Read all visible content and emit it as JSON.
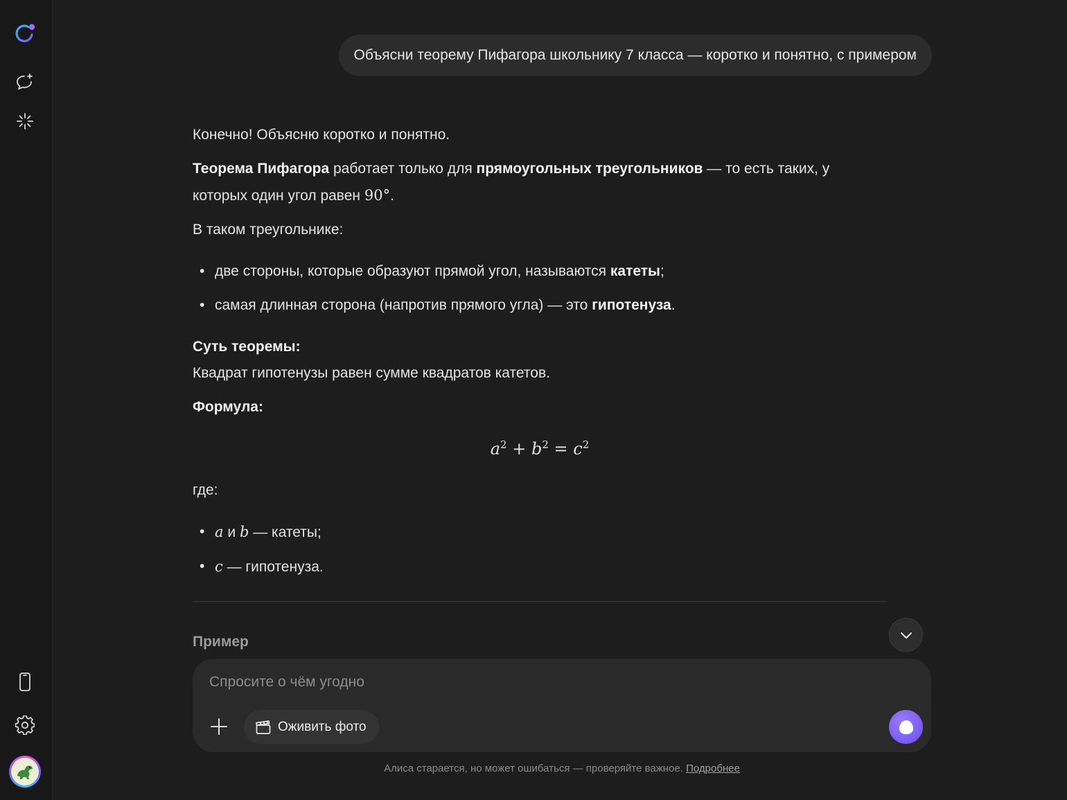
{
  "user_message": "Объясни теорему Пифагора школьнику 7 класса — коротко и понятно, с примером",
  "answer": {
    "intro": "Конечно! Объясню коротко и понятно.",
    "p2_bold1": "Теорема Пифагора",
    "p2_t1": " работает только для ",
    "p2_bold2": "прямоугольных треугольников",
    "p2_t2": " — то есть таких, у которых один угол равен ",
    "p2_angle": "90°",
    "p2_end": ".",
    "p3": "В таком треугольнике:",
    "bullet1_text": "две стороны, которые образуют прямой угол, называются ",
    "bullet1_bold": "катеты",
    "bullet1_end": ";",
    "bullet2_text": "самая длинная сторона (напротив прямого угла) — это ",
    "bullet2_bold": "гипотенуза",
    "bullet2_end": ".",
    "essence_title": "Суть теоремы:",
    "essence_text": "Квадрат гипотенузы равен сумме квадратов катетов.",
    "formula_title": "Формула:",
    "formula": {
      "a": "a",
      "b": "b",
      "c": "c",
      "exp": "2",
      "plus": "+",
      "eq": "="
    },
    "where": "где:",
    "var_a": "a",
    "var_and": " и ",
    "var_b": "b",
    "legs_text": " — катеты;",
    "var_c": "c",
    "hyp_text": " — гипотенуза.",
    "example_title": "Пример"
  },
  "composer": {
    "placeholder": "Спросите о чём угодно",
    "photo_button": "Оживить фото"
  },
  "footer": {
    "text": "Алиса старается, но может ошибаться — проверяйте важное. ",
    "link": "Подробнее"
  },
  "icons": {
    "logo": "alice-logo-icon",
    "new_chat": "new-chat-icon",
    "sparkles": "sparkle-icon",
    "phone": "phone-icon",
    "settings": "gear-icon",
    "avatar": "dinosaur-avatar",
    "scroll": "chevron-down-icon",
    "plus": "plus-icon",
    "photo": "clapperboard-icon",
    "send": "alice-voice-icon"
  },
  "colors": {
    "background": "#1d1d1d",
    "sidebar": "#181818",
    "bubble": "#2c2c2c",
    "accent": "#7b5cff"
  }
}
